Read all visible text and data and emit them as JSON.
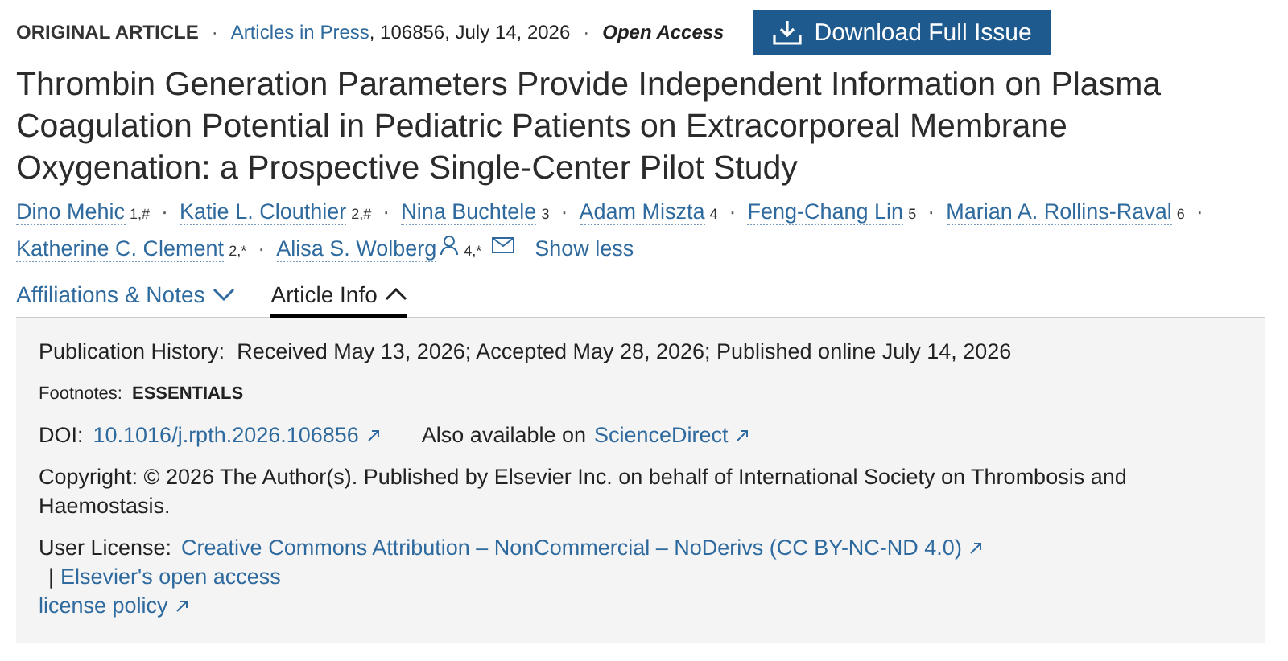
{
  "meta": {
    "article_type": "ORIGINAL ARTICLE",
    "journal_link": "Articles in Press",
    "issue_info": ", 106856, July 14, 2026",
    "access": "Open Access",
    "separator": "·",
    "download_button": "Download Full Issue"
  },
  "title": "Thrombin Generation Parameters Provide Independent Information on Plasma Coagulation Potential in Pediatric Patients on Extracorporeal Membrane Oxygenation: a Prospective Single-Center Pilot Study",
  "authors": [
    {
      "name": "Dino Mehic",
      "sup": "1,#"
    },
    {
      "name": "Katie L. Clouthier",
      "sup": "2,#"
    },
    {
      "name": "Nina Buchtele",
      "sup": "3"
    },
    {
      "name": "Adam Miszta",
      "sup": "4"
    },
    {
      "name": "Feng-Chang Lin",
      "sup": "5"
    },
    {
      "name": "Marian A. Rollins-Raval",
      "sup": "6"
    },
    {
      "name": "Katherine C. Clement",
      "sup": "2,*"
    },
    {
      "name": "Alisa S. Wolberg",
      "sup": "4,*",
      "person_icon": true,
      "email_icon": true
    }
  ],
  "author_separator": "·",
  "show_less": "Show less",
  "tabs": [
    {
      "label": "Affiliations & Notes",
      "selected": false
    },
    {
      "label": "Article Info",
      "selected": true
    }
  ],
  "info": {
    "history_label": "Publication History:",
    "history": "Received May 13, 2026; Accepted May 28, 2026; Published online July 14, 2026",
    "footnotes_label": "Footnotes:",
    "footnotes": "ESSENTIALS",
    "doi_label": "DOI:",
    "doi": "10.1016/j.rpth.2026.106856",
    "also_text": "Also available on",
    "also_link": "ScienceDirect",
    "copyright_label": "Copyright:",
    "copyright": "© 2026 The Author(s). Published by Elsevier Inc. on behalf of International Society on Thrombosis and Haemostasis.",
    "license_label": "User License:",
    "license_link": "Creative Commons Attribution – NonCommercial – NoDerivs (CC BY-NC-ND 4.0)",
    "separator": "|",
    "policy_link_lines": [
      "Elsevier's open access",
      "license policy"
    ]
  }
}
